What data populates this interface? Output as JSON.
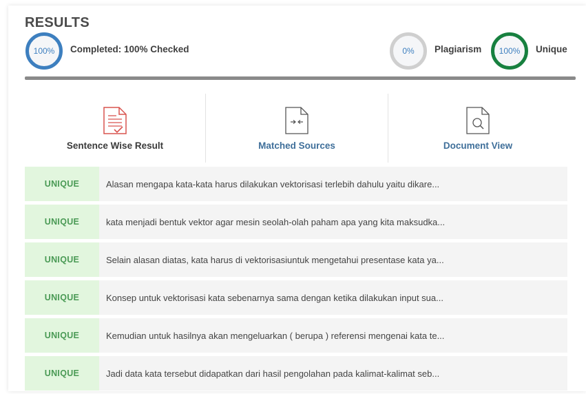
{
  "results": {
    "title": "RESULTS",
    "completed": {
      "percent": "100%",
      "label": "Completed: 100% Checked"
    },
    "plagiarism": {
      "percent": "0%",
      "label": "Plagiarism"
    },
    "unique": {
      "percent": "100%",
      "label": "Unique"
    },
    "progress_fraction": 1.0
  },
  "tabs": [
    {
      "label": "Sentence Wise Result",
      "icon": "document-check-icon"
    },
    {
      "label": "Matched Sources",
      "icon": "document-compare-icon"
    },
    {
      "label": "Document View",
      "icon": "document-search-icon"
    }
  ],
  "rows": [
    {
      "status": "UNIQUE",
      "text": "Alasan mengapa kata-kata harus dilakukan vektorisasi terlebih dahulu yaitu dikare..."
    },
    {
      "status": "UNIQUE",
      "text": "kata menjadi bentuk vektor agar mesin seolah-olah paham apa yang kita maksudka..."
    },
    {
      "status": "UNIQUE",
      "text": "Selain alasan diatas, kata harus di vektorisasiuntuk mengetahui presentase kata ya..."
    },
    {
      "status": "UNIQUE",
      "text": "Konsep untuk vektorisasi kata sebenarnya sama dengan ketika dilakukan input sua..."
    },
    {
      "status": "UNIQUE",
      "text": "Kemudian untuk hasilnya akan mengeluarkan ( berupa ) referensi mengenai kata te..."
    },
    {
      "status": "UNIQUE",
      "text": "Jadi data kata tersebut didapatkan dari hasil pengolahan pada kalimat-kalimat seb..."
    }
  ],
  "colors": {
    "completed_ring": "#3d7fbf",
    "plagiarism_ring": "#cfcfcf",
    "unique_ring": "#17803f",
    "unique_badge_bg": "#e2f6de",
    "unique_badge_text": "#4a9a55"
  }
}
